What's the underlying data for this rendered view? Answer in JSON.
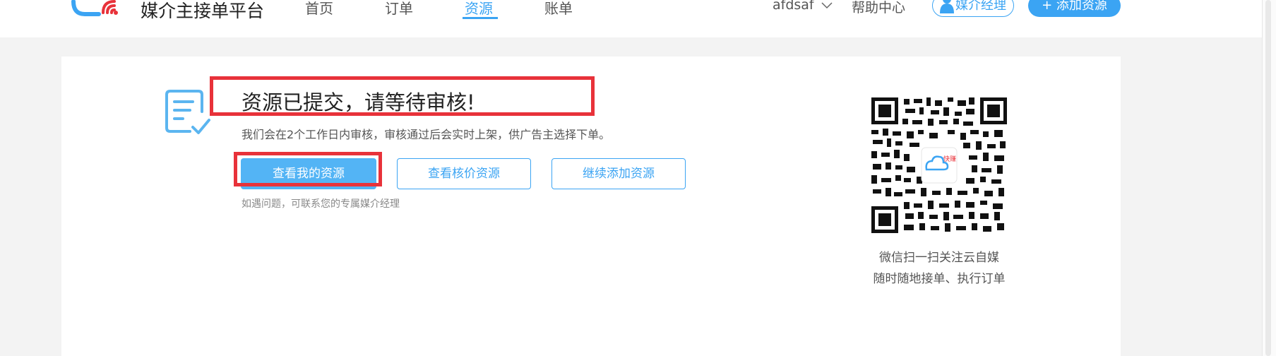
{
  "header": {
    "brand": "媒介主接单平台",
    "nav": [
      {
        "label": "首页"
      },
      {
        "label": "订单"
      },
      {
        "label": "资源",
        "active": true
      },
      {
        "label": "账单"
      }
    ],
    "user": "afdsaf",
    "help": "帮助中心",
    "manager_button": "媒介经理",
    "add_button": "+ 添加资源",
    "accent_color": "#3ba4f3"
  },
  "main": {
    "title": "资源已提交，请等待审核!",
    "subtitle": "我们会在2个工作日内审核，审核通过后会实时上架，供广告主选择下单。",
    "buttons": {
      "view_mine": "查看我的资源",
      "view_price": "查看核价资源",
      "continue_add": "继续添加资源"
    },
    "hint": "如遇问题，可联系您的专属媒介经理",
    "highlight_color": "#e8323a"
  },
  "qr": {
    "center_label": "快赚",
    "caption_line1": "微信扫一扫关注云自媒",
    "caption_line2": "随时随地接单、执行订单"
  },
  "icons": {
    "chevron": "chevron-down-icon",
    "person": "person-icon",
    "document": "document-check-icon"
  }
}
